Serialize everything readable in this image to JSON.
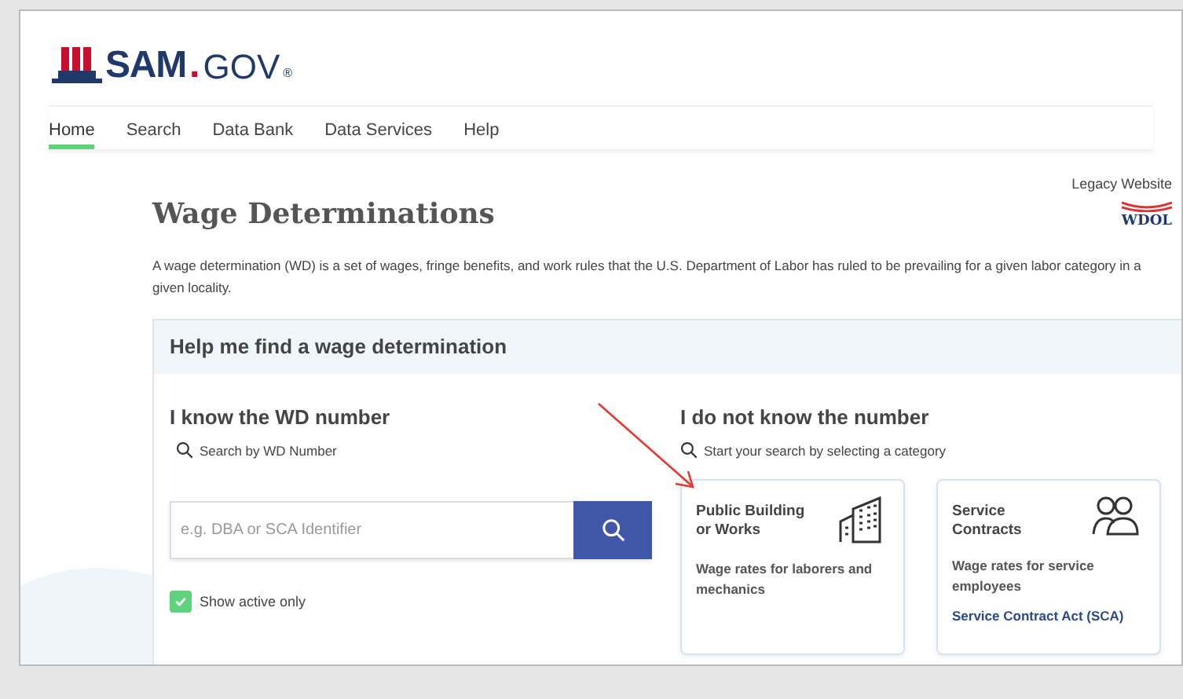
{
  "header": {
    "logo_text": "SAM",
    "logo_dot": ".",
    "logo_suffix": "GOV",
    "logo_mark": "®"
  },
  "nav": [
    {
      "label": "Home",
      "selected": true
    },
    {
      "label": "Search",
      "selected": false
    },
    {
      "label": "Data Bank",
      "selected": false
    },
    {
      "label": "Data Services",
      "selected": false
    },
    {
      "label": "Help",
      "selected": false
    }
  ],
  "page": {
    "title": "Wage Determinations",
    "legacy_label": "Legacy Website",
    "legacy_logo": "WDOL",
    "description": "A wage determination (WD) is a set of wages, fringe benefits, and work rules that the U.S. Department of Labor has ruled to be prevailing for a given labor category in a given locality."
  },
  "panel": {
    "title": "Help me find a wage determination",
    "known": {
      "heading": "I know the WD number",
      "hint": "Search by WD Number",
      "search": {
        "placeholder": "e.g. DBA or SCA Identifier"
      },
      "show_active": {
        "label": "Show active only",
        "checked": true
      }
    },
    "unknown": {
      "heading": "I do not know the number",
      "hint": "Start your search by selecting a category",
      "cards": [
        {
          "kind": "building",
          "title": "Public Building or Works",
          "description": "Wage rates for laborers and mechanics"
        },
        {
          "kind": "people",
          "title": "Service Contracts",
          "description": "Wage rates for service employees",
          "link": "Service Contract Act (SCA)"
        }
      ]
    }
  }
}
